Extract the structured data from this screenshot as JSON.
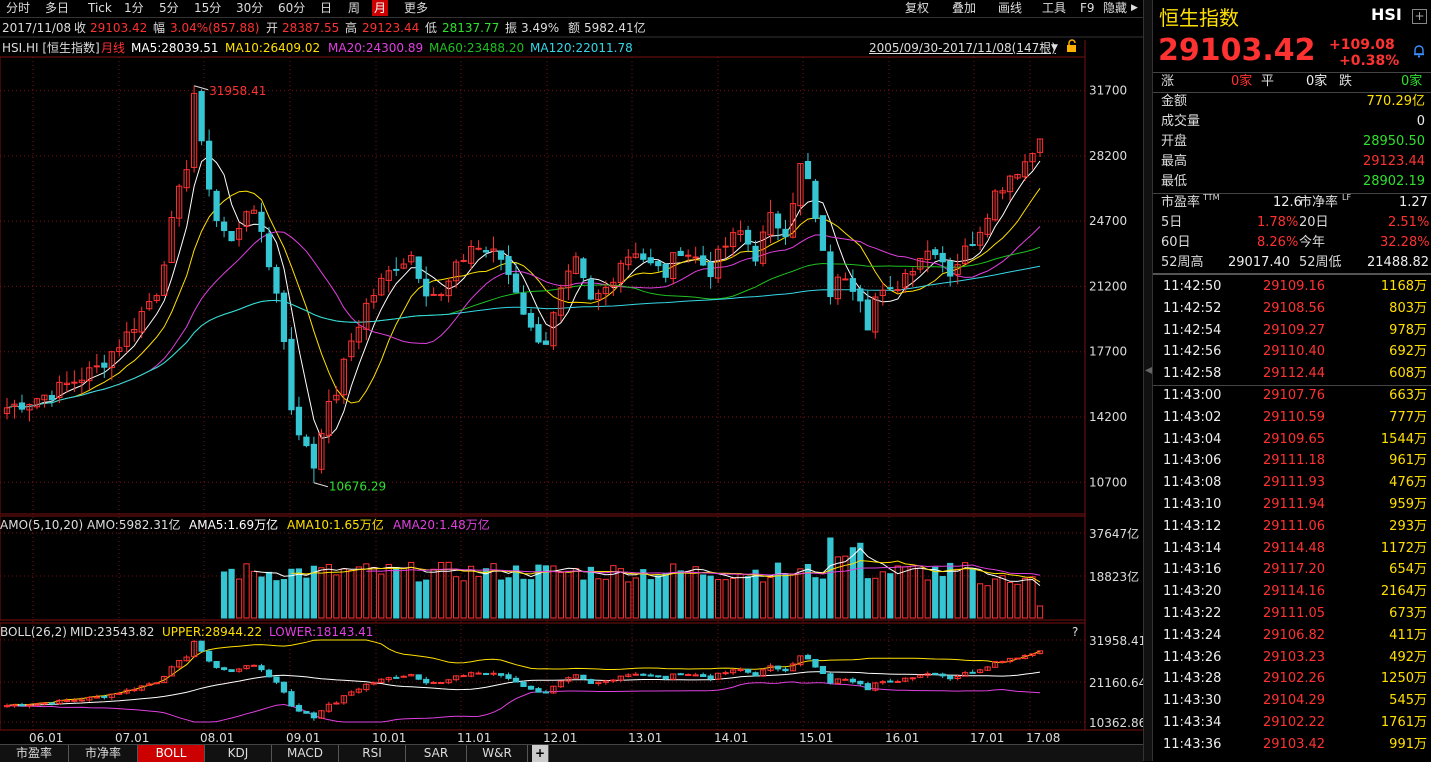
{
  "toolbar": {
    "periods": [
      "分时",
      "多日",
      "Tick",
      "1分",
      "5分",
      "15分",
      "30分",
      "60分",
      "日",
      "周",
      "月",
      "更多"
    ],
    "active": "月",
    "right_items": [
      "复权",
      "叠加",
      "画线",
      "工具",
      "F9",
      "隐藏"
    ]
  },
  "infobar": {
    "date": "2017/11/08",
    "close_label": "收",
    "close_value": "29103.42",
    "change_label": "幅",
    "change_value": "3.04%(857.88)",
    "open_label": "开",
    "open_value": "28387.55",
    "high_label": "高",
    "high_value": "29123.44",
    "low_label": "低",
    "low_value": "28137.77",
    "amp_label": "振",
    "amp_value": "3.49%",
    "amount_label": "额",
    "amount_value": "5982.41亿"
  },
  "mainhead": {
    "symbol": "HSI.HI [恒生指数]",
    "period": "月线",
    "ma5": "MA5:28039.51",
    "ma10": "MA10:26409.02",
    "ma20": "MA20:24300.89",
    "ma60": "MA60:23488.20",
    "ma120": "MA120:22011.78",
    "range": "2005/09/30-2017/11/08(147根)"
  },
  "amo_head": {
    "title": "AMO(5,10,20)",
    "amo": "AMO:5982.31亿",
    "ama5": "AMA5:1.69万亿",
    "ama10": "AMA10:1.65万亿",
    "ama20": "AMA20:1.48万亿"
  },
  "boll_head": {
    "title": "BOLL(26,2)",
    "mid": "MID:23543.82",
    "upper": "UPPER:28944.22",
    "lower": "LOWER:18143.41",
    "help": "?"
  },
  "chart_data": [
    {
      "type": "candlestick",
      "title": "HSI.HI [恒生指数] 月线",
      "y_ticks": [
        "31700",
        "28200",
        "24700",
        "21200",
        "17700",
        "14200",
        "10700"
      ],
      "ylim": [
        9000,
        33500
      ],
      "max_label": "31958.41",
      "min_label": "10676.29",
      "x_ticks": [
        "06.01",
        "07.01",
        "08.01",
        "09.01",
        "10.01",
        "11.01",
        "12.01",
        "13.01",
        "14.01",
        "15.01",
        "16.01",
        "17.01",
        "17.08"
      ],
      "last": {
        "open": 28387.55,
        "high": 29123.44,
        "low": 28137.77,
        "close": 29103.42
      },
      "colors": {
        "up": "#ff3232",
        "down": "#36c6d3",
        "ma5": "#ffffff",
        "ma10": "#ffe000",
        "ma20": "#e040e0",
        "ma60": "#20c020",
        "ma120": "#36d6e6"
      }
    },
    {
      "type": "bar",
      "title": "AMO(5,10,20)",
      "y_ticks": [
        "37647亿",
        "18823亿"
      ]
    },
    {
      "type": "line",
      "title": "BOLL(26,2)",
      "y_ticks": [
        "31958.41",
        "21160.64",
        "10362.86"
      ]
    }
  ],
  "bottom_tabs": [
    "市盈率",
    "市净率",
    "BOLL",
    "KDJ",
    "MACD",
    "RSI",
    "SAR",
    "W&R"
  ],
  "bottom_active": "BOLL",
  "quote": {
    "name": "恒生指数",
    "code": "HSI",
    "price": "29103.42",
    "change": "+109.08",
    "change_pct": "+0.38%",
    "breadth": {
      "up_label": "涨",
      "up": "0家",
      "flat_label": "平",
      "flat": "0家",
      "down_label": "跌",
      "down": "0家"
    },
    "fields": [
      {
        "label": "金额",
        "value": "770.29亿",
        "color": "yellow"
      },
      {
        "label": "成交量",
        "value": "0",
        "color": "white"
      },
      {
        "label": "开盘",
        "value": "28950.50",
        "color": "green"
      },
      {
        "label": "最高",
        "value": "29123.44",
        "color": "red"
      },
      {
        "label": "最低",
        "value": "28902.19",
        "color": "green"
      }
    ],
    "pe_label": "市盈率",
    "pe_sup": "TTM",
    "pe": "12.6",
    "pb_label": "市净率",
    "pb_sup": "LF",
    "pb": "1.27",
    "d5_label": "5日",
    "d5": "1.78%",
    "d20_label": "20日",
    "d20": "2.51%",
    "d60_label": "60日",
    "d60": "8.26%",
    "ytd_label": "今年",
    "ytd": "32.28%",
    "w52h_label": "52周高",
    "w52h": "29017.40",
    "w52l_label": "52周低",
    "w52l": "21488.82"
  },
  "ticks": [
    {
      "time": "11:42:50",
      "price": "29109.16",
      "vol": "1168万"
    },
    {
      "time": "11:42:52",
      "price": "29108.56",
      "vol": "803万"
    },
    {
      "time": "11:42:54",
      "price": "29109.27",
      "vol": "978万"
    },
    {
      "time": "11:42:56",
      "price": "29110.40",
      "vol": "692万"
    },
    {
      "time": "11:42:58",
      "price": "29112.44",
      "vol": "608万"
    },
    {
      "time": "11:43:00",
      "price": "29107.76",
      "vol": "663万"
    },
    {
      "time": "11:43:02",
      "price": "29110.59",
      "vol": "777万"
    },
    {
      "time": "11:43:04",
      "price": "29109.65",
      "vol": "1544万"
    },
    {
      "time": "11:43:06",
      "price": "29111.18",
      "vol": "961万"
    },
    {
      "time": "11:43:08",
      "price": "29111.93",
      "vol": "476万"
    },
    {
      "time": "11:43:10",
      "price": "29111.94",
      "vol": "959万"
    },
    {
      "time": "11:43:12",
      "price": "29111.06",
      "vol": "293万"
    },
    {
      "time": "11:43:14",
      "price": "29114.48",
      "vol": "1172万"
    },
    {
      "time": "11:43:16",
      "price": "29117.20",
      "vol": "654万"
    },
    {
      "time": "11:43:20",
      "price": "29114.16",
      "vol": "2164万"
    },
    {
      "time": "11:43:22",
      "price": "29111.05",
      "vol": "673万"
    },
    {
      "time": "11:43:24",
      "price": "29106.82",
      "vol": "411万"
    },
    {
      "time": "11:43:26",
      "price": "29103.23",
      "vol": "492万"
    },
    {
      "time": "11:43:28",
      "price": "29102.26",
      "vol": "1250万"
    },
    {
      "time": "11:43:30",
      "price": "29104.29",
      "vol": "545万"
    },
    {
      "time": "11:43:34",
      "price": "29102.22",
      "vol": "1761万"
    },
    {
      "time": "11:43:36",
      "price": "29103.42",
      "vol": "991万"
    }
  ]
}
